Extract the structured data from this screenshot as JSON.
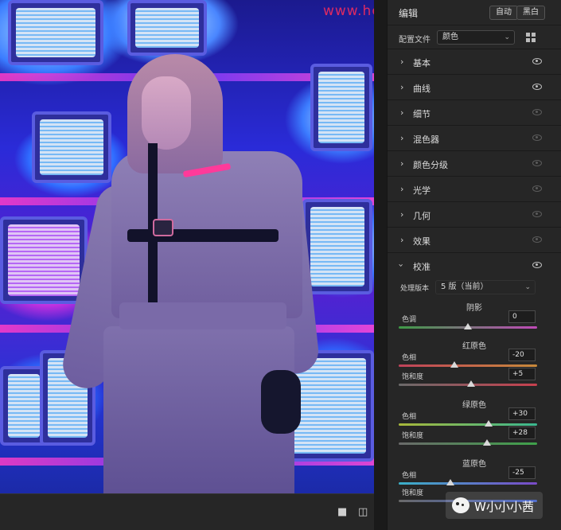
{
  "watermark_top": "www.hongxiaoshan.com",
  "panel": {
    "title": "编辑",
    "auto_label": "自动",
    "bw_label": "黑白",
    "profile_label": "配置文件",
    "profile_value": "颜色"
  },
  "sections": [
    {
      "name": "基本",
      "open": false,
      "eye_active": true
    },
    {
      "name": "曲线",
      "open": false,
      "eye_active": true
    },
    {
      "name": "细节",
      "open": false,
      "eye_active": false
    },
    {
      "name": "混色器",
      "open": false,
      "eye_active": false
    },
    {
      "name": "颜色分级",
      "open": false,
      "eye_active": false
    },
    {
      "name": "光学",
      "open": false,
      "eye_active": false
    },
    {
      "name": "几何",
      "open": false,
      "eye_active": false
    },
    {
      "name": "效果",
      "open": false,
      "eye_active": false
    },
    {
      "name": "校准",
      "open": true,
      "eye_active": true
    }
  ],
  "calibration": {
    "process_label": "处理版本",
    "process_value": "5 版（当前）",
    "shadows": {
      "title": "阴影",
      "tint_label": "色调",
      "tint_value": "0",
      "tint": 0
    },
    "red": {
      "title": "红原色",
      "hue_label": "色相",
      "hue_value": "-20",
      "hue": -20,
      "sat_label": "饱和度",
      "sat_value": "+5",
      "sat": 5
    },
    "green": {
      "title": "绿原色",
      "hue_label": "色相",
      "hue_value": "+30",
      "hue": 30,
      "sat_label": "饱和度",
      "sat_value": "+28",
      "sat": 28
    },
    "blue": {
      "title": "蓝原色",
      "hue_label": "色相",
      "hue_value": "-25",
      "hue": -25,
      "sat_label": "饱和度"
    }
  },
  "watermark_bottom": "W小小小茜",
  "colors": {
    "accent_eye": "#bdbdbd",
    "panel_bg": "#262626"
  }
}
